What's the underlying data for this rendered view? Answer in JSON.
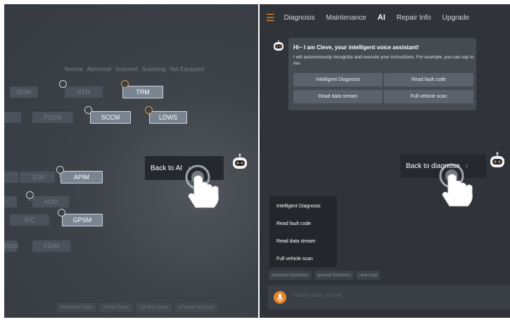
{
  "left_panel": {
    "legend": [
      "Normal",
      "Abnormal",
      "Scanned",
      "Scanning",
      "Not Equipped"
    ],
    "modules": {
      "rtm": "RTM",
      "rdm": "RDM",
      "trm": "TRM",
      "pscm": "PSCM",
      "sccm": "SCCM",
      "ldws": "LDWS",
      "tcm": "TCM",
      "apim": "APIM",
      "acm": "ACM",
      "gpsm": "GPSM",
      "fdim": "FDIM",
      "ipc": "IPC",
      "pcm": "PCM"
    },
    "back_button": "Back to AI",
    "bottom_buttons": [
      "Historical Data",
      "Smart Scan",
      "System Scan",
      "Choose to Scan"
    ]
  },
  "right_panel": {
    "nav": {
      "menu_icon": "hamburger-icon",
      "tabs": [
        "Diagnosis",
        "Maintenance",
        "AI",
        "Repair Info",
        "Upgrade"
      ],
      "active": "AI"
    },
    "greeting": {
      "title": "Hi~ I am Cleve, your intelligent voice assistant!",
      "body": "I will autonomously recognize and execute your instructions. For example, you can say to me:",
      "buttons": [
        "Intelligent Diagnosis",
        "Read fault code",
        "Read data stream",
        "Full vehicle scan"
      ]
    },
    "back_button": "Back to diagnose",
    "commands": [
      "Intelligent Diagnosis",
      "Read fault code",
      "Read data stream",
      "Full vehicle scan"
    ],
    "chips": [
      "common functions",
      "special functions",
      "new chat"
    ],
    "input_placeholder": "Cleve is here, you say"
  },
  "colors": {
    "accent": "#e8862a",
    "panel_bg": "#30343a",
    "blue_band": "#2f62b8"
  }
}
